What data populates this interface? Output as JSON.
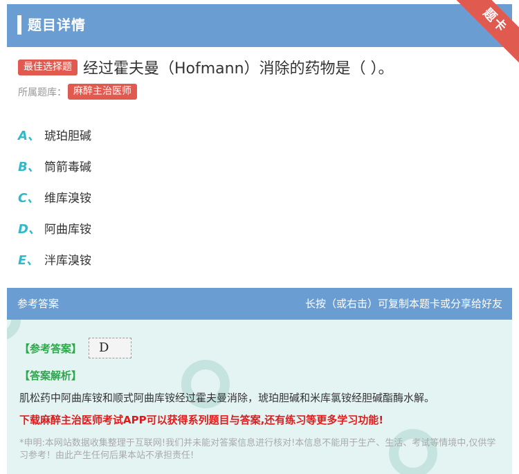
{
  "header": {
    "title": "题目详情",
    "ribbon": "题卡"
  },
  "question": {
    "type_tag": "最佳选择题",
    "text": "经过霍夫曼（Hofmann）消除的药物是（ ）。",
    "library_label": "所属题库：",
    "library_tag": "麻醉主治医师"
  },
  "options": [
    {
      "letter": "A、",
      "text": "琥珀胆碱"
    },
    {
      "letter": "B、",
      "text": "筒箭毒碱"
    },
    {
      "letter": "C、",
      "text": "维库溴铵"
    },
    {
      "letter": "D、",
      "text": "阿曲库铵"
    },
    {
      "letter": "E、",
      "text": "泮库溴铵"
    }
  ],
  "answer_section": {
    "title": "参考答案",
    "hint": "长按（或右击）可复制本题卡或分享给好友",
    "answer_label": "【参考答案】",
    "answer_value": "D",
    "analysis_label": "【答案解析】",
    "analysis_text": "肌松药中阿曲库铵和顺式阿曲库铵经过霍夫曼消除，琥珀胆碱和米库氯铵经胆碱酯酶水解。",
    "promo": "下载麻醉主治医师考试APP可以获得系列题目与答案,还有练习等更多学习功能!",
    "notice": "*申明:本网站数据收集整理于互联网!我们并未能对答案信息进行核对!本信息不能用于生产、生活、考试等情境中,仅供学习参考！由此产生任何后果本站不承担责任!"
  }
}
